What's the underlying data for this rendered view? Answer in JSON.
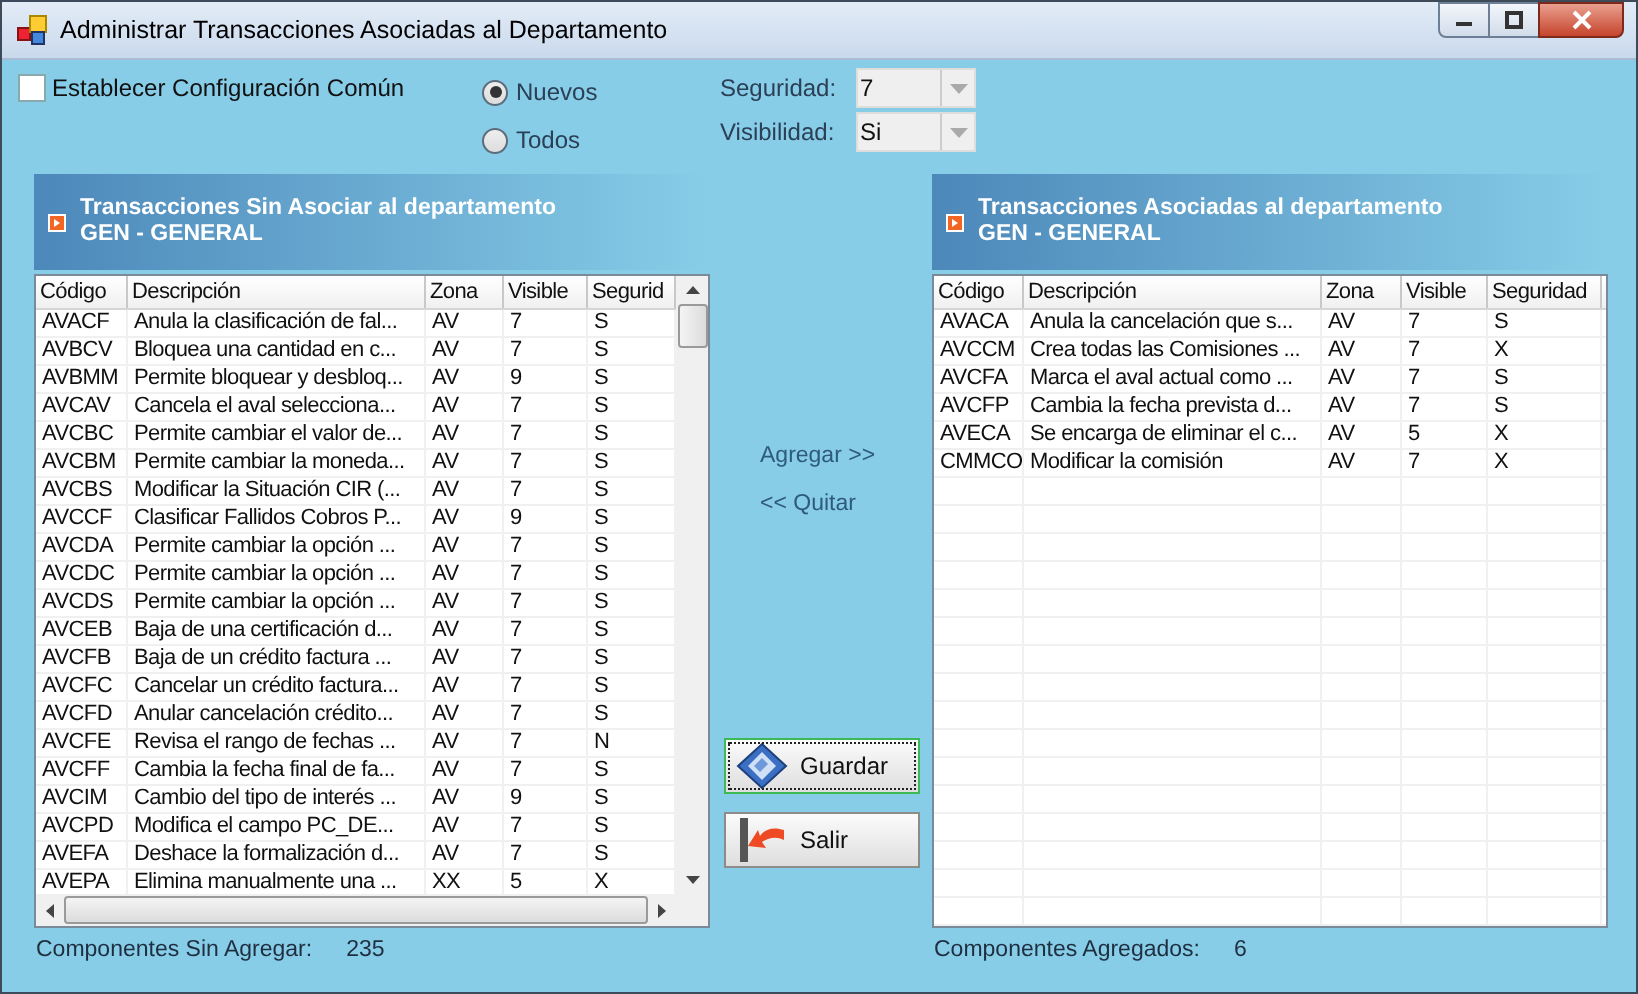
{
  "window": {
    "title": "Administrar Transacciones Asociadas al Departamento"
  },
  "common_config": {
    "label": "Establecer Configuración Común",
    "checked": false
  },
  "filter": [
    {
      "label": "Nuevos",
      "selected": true
    },
    {
      "label": "Todos",
      "selected": false
    }
  ],
  "fields": [
    {
      "label": "Seguridad:",
      "value": "7",
      "disabled": true
    },
    {
      "label": "Visibilidad:",
      "value": "Si",
      "disabled": true
    }
  ],
  "left_panel": {
    "title": "Transacciones Sin Asociar al departamento",
    "subtitle": "GEN - GENERAL",
    "columns": [
      "Código",
      "Descripción",
      "Zona",
      "Visible",
      "Segurid"
    ],
    "rows": [
      [
        "AVACF",
        "Anula la clasificación de fal...",
        "AV",
        "7",
        "S"
      ],
      [
        "AVBCV",
        "Bloquea una cantidad en c...",
        "AV",
        "7",
        "S"
      ],
      [
        "AVBMM",
        "Permite bloquear y desbloq...",
        "AV",
        "9",
        "S"
      ],
      [
        "AVCAV",
        "Cancela el aval selecciona...",
        "AV",
        "7",
        "S"
      ],
      [
        "AVCBC",
        "Permite cambiar el valor de...",
        "AV",
        "7",
        "S"
      ],
      [
        "AVCBM",
        "Permite cambiar la moneda...",
        "AV",
        "7",
        "S"
      ],
      [
        "AVCBS",
        "Modificar la Situación CIR (...",
        "AV",
        "7",
        "S"
      ],
      [
        "AVCCF",
        "Clasificar Fallidos Cobros P...",
        "AV",
        "9",
        "S"
      ],
      [
        "AVCDA",
        "Permite cambiar la opción ...",
        "AV",
        "7",
        "S"
      ],
      [
        "AVCDC",
        "Permite cambiar la opción ...",
        "AV",
        "7",
        "S"
      ],
      [
        "AVCDS",
        "Permite cambiar la opción ...",
        "AV",
        "7",
        "S"
      ],
      [
        "AVCEB",
        "Baja de una certificación d...",
        "AV",
        "7",
        "S"
      ],
      [
        "AVCFB",
        "Baja de un crédito factura ...",
        "AV",
        "7",
        "S"
      ],
      [
        "AVCFC",
        "Cancelar un crédito factura...",
        "AV",
        "7",
        "S"
      ],
      [
        "AVCFD",
        "Anular cancelación crédito...",
        "AV",
        "7",
        "S"
      ],
      [
        "AVCFE",
        "Revisa el rango de fechas ...",
        "AV",
        "7",
        "N"
      ],
      [
        "AVCFF",
        "Cambia la fecha final de fa...",
        "AV",
        "7",
        "S"
      ],
      [
        "AVCIM",
        "Cambio del tipo de interés ...",
        "AV",
        "9",
        "S"
      ],
      [
        "AVCPD",
        "Modifica el campo PC_DE...",
        "AV",
        "7",
        "S"
      ],
      [
        "AVEFA",
        "Deshace la formalización d...",
        "AV",
        "7",
        "S"
      ],
      [
        "AVEPA",
        "Elimina manualmente una ...",
        "XX",
        "5",
        "X"
      ]
    ],
    "footer_label": "Componentes Sin Agregar:",
    "footer_value": "235"
  },
  "actions": [
    "Agregar >>",
    "<< Quitar"
  ],
  "buttons": [
    {
      "label": "Guardar",
      "kind": "save",
      "focused": true
    },
    {
      "label": "Salir",
      "kind": "exit",
      "focused": false
    }
  ],
  "right_panel": {
    "title": "Transacciones Asociadas al departamento",
    "subtitle": "GEN - GENERAL",
    "columns": [
      "Código",
      "Descripción",
      "Zona",
      "Visible",
      "Seguridad"
    ],
    "rows": [
      [
        "AVACA",
        "Anula la cancelación que s...",
        "AV",
        "7",
        "S"
      ],
      [
        "AVCCM",
        "Crea todas las Comisiones ...",
        "AV",
        "7",
        "X"
      ],
      [
        "AVCFA",
        "Marca el aval actual como ...",
        "AV",
        "7",
        "S"
      ],
      [
        "AVCFP",
        "Cambia la fecha prevista d...",
        "AV",
        "7",
        "S"
      ],
      [
        "AVECA",
        "Se encarga de eliminar el c...",
        "AV",
        "5",
        "X"
      ],
      [
        "CMMCO",
        "Modificar la comisión",
        "AV",
        "7",
        "X"
      ]
    ],
    "footer_label": "Componentes Agregados:",
    "footer_value": "6"
  }
}
